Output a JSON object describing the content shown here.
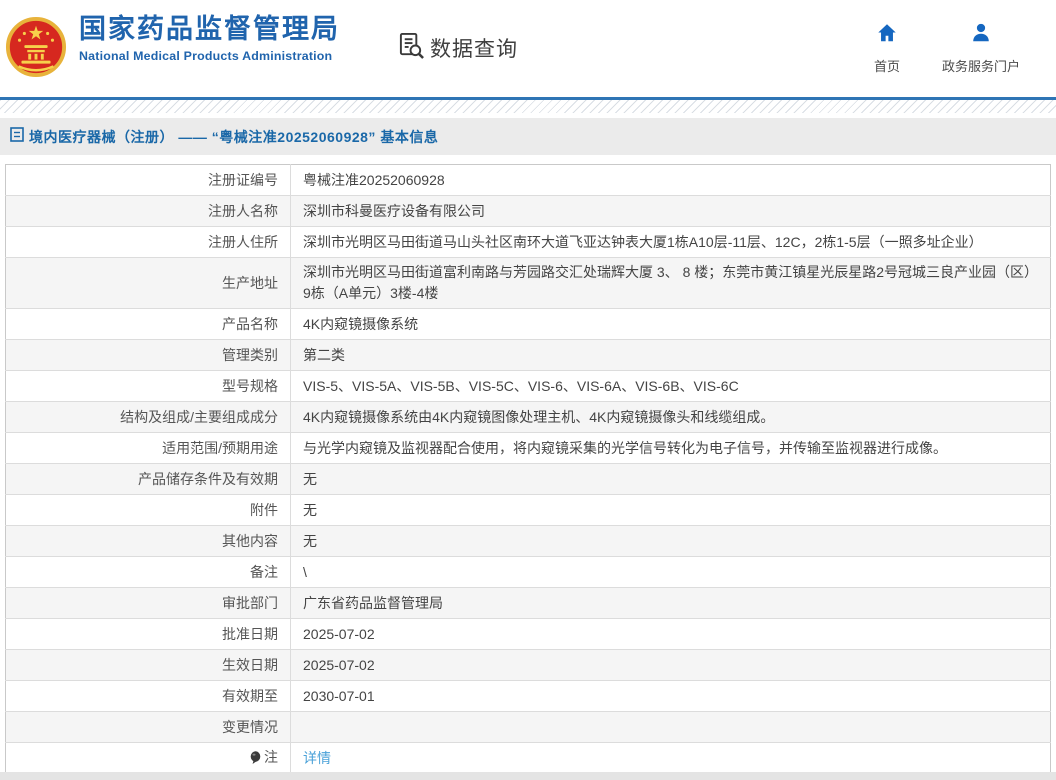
{
  "header": {
    "agency_name_zh": "国家药品监督管理局",
    "agency_name_en": "National Medical Products Administration",
    "data_query_label": "数据查询",
    "home_label": "首页",
    "portal_label": "政务服务门户"
  },
  "breadcrumb": {
    "label": "境内医疗器械（注册） —— “粤械注准20252060928” 基本信息"
  },
  "detail_table": {
    "rows": [
      {
        "label": "注册证编号",
        "value": "粤械注准20252060928"
      },
      {
        "label": "注册人名称",
        "value": "深圳市科曼医疗设备有限公司"
      },
      {
        "label": "注册人住所",
        "value": "深圳市光明区马田街道马山头社区南环大道飞亚达钟表大厦1栋A10层-11层、12C，2栋1-5层（一照多址企业）"
      },
      {
        "label": "生产地址",
        "value": "深圳市光明区马田街道富利南路与芳园路交汇处瑞辉大厦 3、 8 楼；东莞市黄江镇星光辰星路2号冠城三良产业园（区）9栋（A单元）3楼-4楼"
      },
      {
        "label": "产品名称",
        "value": "4K内窥镜摄像系统"
      },
      {
        "label": "管理类别",
        "value": "第二类"
      },
      {
        "label": "型号规格",
        "value": "VIS-5、VIS-5A、VIS-5B、VIS-5C、VIS-6、VIS-6A、VIS-6B、VIS-6C"
      },
      {
        "label": "结构及组成/主要组成成分",
        "value": "4K内窥镜摄像系统由4K内窥镜图像处理主机、4K内窥镜摄像头和线缆组成。"
      },
      {
        "label": "适用范围/预期用途",
        "value": "与光学内窥镜及监视器配合使用，将内窥镜采集的光学信号转化为电子信号，并传输至监视器进行成像。"
      },
      {
        "label": "产品储存条件及有效期",
        "value": "无"
      },
      {
        "label": "附件",
        "value": "无"
      },
      {
        "label": "其他内容",
        "value": "无"
      },
      {
        "label": "备注",
        "value": "\\"
      },
      {
        "label": "审批部门",
        "value": "广东省药品监督管理局"
      },
      {
        "label": "批准日期",
        "value": "2025-07-02"
      },
      {
        "label": "生效日期",
        "value": "2025-07-02"
      },
      {
        "label": "有效期至",
        "value": "2030-07-01"
      },
      {
        "label": "变更情况",
        "value": ""
      },
      {
        "label": "注",
        "value": "详情"
      }
    ]
  },
  "colors": {
    "brand_blue": "#2064ad",
    "nav_icon_blue": "#1567c0",
    "breadcrumb_blue": "#1a68a8",
    "link_blue": "#4aa1d8",
    "zebra_gray": "#f5f5f5",
    "accent_line_blue": "#2e75b5"
  }
}
